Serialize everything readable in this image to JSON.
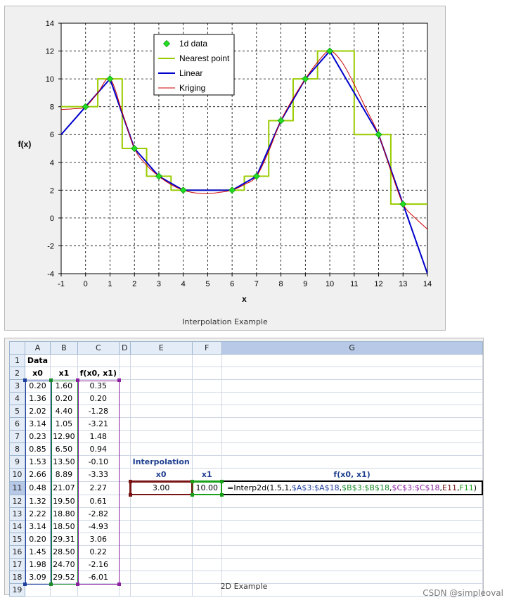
{
  "chart": {
    "caption": "Interpolation Example",
    "legend": [
      "1d data",
      "Nearest point",
      "Linear",
      "Kriging"
    ]
  },
  "colors": {
    "data_marker": "#22dd22",
    "nearest": "#99cc00",
    "linear": "#0000cc",
    "kriging": "#cc0000",
    "x0_range": "#1f3f9f",
    "x1_range": "#1a8a2a",
    "f_range": "#8a1fa0",
    "e11": "#7a1414",
    "f11": "#19a019"
  },
  "chart_data": {
    "type": "line",
    "title": "",
    "xlabel": "x",
    "ylabel": "f(x)",
    "xlim": [
      -1,
      14
    ],
    "ylim": [
      -4,
      14
    ],
    "xticks": [
      "-1",
      "0",
      "1",
      "2",
      "3",
      "4",
      "5",
      "6",
      "7",
      "8",
      "9",
      "10",
      "11",
      "12",
      "13",
      "14"
    ],
    "yticks": [
      "-4",
      "-2",
      "0",
      "2",
      "4",
      "6",
      "8",
      "10",
      "12",
      "14"
    ],
    "grid": true,
    "legend_position": "top-center",
    "series": [
      {
        "name": "1d data",
        "kind": "scatter",
        "x": [
          0,
          1,
          2,
          3,
          4,
          6,
          7,
          8,
          9,
          10,
          12,
          13
        ],
        "y": [
          8,
          10,
          5,
          3,
          2,
          2,
          3,
          7,
          10,
          12,
          6,
          1
        ]
      },
      {
        "name": "Nearest point",
        "kind": "step",
        "x": [
          -1,
          0.5,
          0.5,
          1.5,
          1.5,
          2.5,
          2.5,
          3.5,
          3.5,
          6.5,
          6.5,
          7.5,
          7.5,
          8.5,
          8.5,
          9.5,
          9.5,
          11,
          11,
          12.5,
          12.5,
          14
        ],
        "y": [
          8,
          8,
          10,
          10,
          5,
          5,
          3,
          3,
          2,
          2,
          3,
          3,
          7,
          7,
          10,
          10,
          12,
          12,
          6,
          6,
          1,
          1
        ]
      },
      {
        "name": "Linear",
        "kind": "line",
        "x": [
          -1,
          0,
          1,
          2,
          3,
          4,
          6,
          7,
          8,
          9,
          10,
          12,
          13,
          14
        ],
        "y": [
          6,
          8,
          10,
          5,
          3,
          2,
          2,
          3,
          7,
          10,
          12,
          6,
          1,
          -4
        ]
      },
      {
        "name": "Kriging",
        "kind": "smooth",
        "x": [
          -1,
          -0.5,
          0,
          0.5,
          1,
          1.5,
          2,
          2.5,
          3,
          3.5,
          4,
          4.5,
          5,
          5.5,
          6,
          6.5,
          7,
          7.5,
          8,
          8.5,
          9,
          9.5,
          10,
          10.5,
          11,
          11.5,
          12,
          12.5,
          13,
          13.5,
          14
        ],
        "y": [
          7.8,
          7.85,
          8,
          9,
          10,
          7.6,
          5,
          3.8,
          3,
          2.4,
          2,
          1.8,
          1.75,
          1.85,
          2,
          2.4,
          3,
          4.8,
          7,
          8.6,
          10,
          11.2,
          12,
          11.2,
          9.6,
          7.8,
          6,
          3.4,
          1,
          0,
          -0.8
        ]
      }
    ]
  },
  "sheet": {
    "caption": "2D Example",
    "col_headers": [
      "A",
      "B",
      "C",
      "D",
      "E",
      "F",
      "G"
    ],
    "row_headers": [
      "1",
      "2",
      "3",
      "4",
      "5",
      "6",
      "7",
      "8",
      "9",
      "10",
      "11",
      "12",
      "13",
      "14",
      "15",
      "16",
      "17",
      "18",
      "19"
    ],
    "title_cell": "Data",
    "headers": [
      "x0",
      "x1",
      "f(x0, x1)"
    ],
    "data": [
      [
        "0.20",
        "1.60",
        "0.35"
      ],
      [
        "1.36",
        "0.20",
        "0.20"
      ],
      [
        "2.02",
        "4.40",
        "-1.28"
      ],
      [
        "3.14",
        "1.05",
        "-3.21"
      ],
      [
        "0.23",
        "12.90",
        "1.48"
      ],
      [
        "0.85",
        "6.50",
        "0.94"
      ],
      [
        "1.53",
        "13.50",
        "-0.10"
      ],
      [
        "2.66",
        "8.89",
        "-3.33"
      ],
      [
        "0.48",
        "21.07",
        "2.27"
      ],
      [
        "1.32",
        "19.50",
        "0.61"
      ],
      [
        "2.22",
        "18.80",
        "-2.82"
      ],
      [
        "3.14",
        "18.50",
        "-4.93"
      ],
      [
        "0.20",
        "29.31",
        "3.06"
      ],
      [
        "1.45",
        "28.50",
        "0.22"
      ],
      [
        "1.98",
        "24.70",
        "-2.16"
      ],
      [
        "3.09",
        "29.52",
        "-6.01"
      ]
    ],
    "interp_label": "Interpolation",
    "interp_x0_label": "x0",
    "interp_x1_label": "x1",
    "interp_f_label": "f(x0, x1)",
    "x0_value": "3.00",
    "x1_value": "10.00",
    "formula": {
      "p0": "=Interp2d(1.5,1,",
      "p1": "$A$3:$A$18",
      "p2": ",",
      "p3": "$B$3:$B$18",
      "p4": ",",
      "p5": "$C$3:$C$18",
      "p6": ",",
      "p7": "E11",
      "p8": ",",
      "p9": "F11",
      "p10": ")"
    }
  },
  "watermark": "CSDN @simpleoval"
}
